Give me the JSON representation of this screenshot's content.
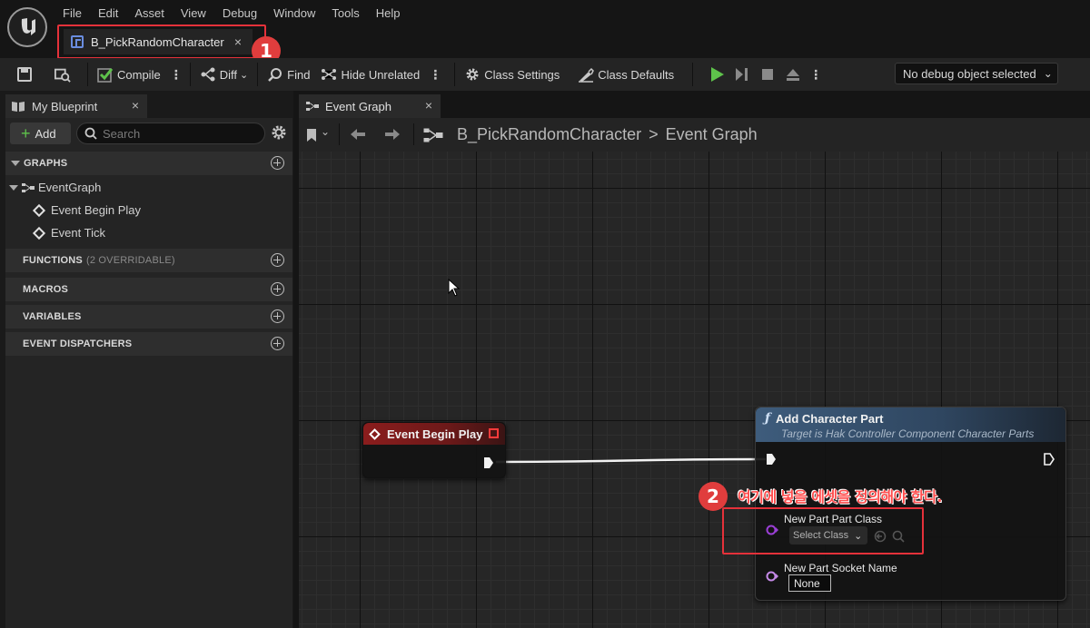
{
  "menu": [
    "File",
    "Edit",
    "Asset",
    "View",
    "Debug",
    "Window",
    "Tools",
    "Help"
  ],
  "document_tab": {
    "label": "B_PickRandomCharacter",
    "close": "×"
  },
  "badges": {
    "one": "1",
    "two": "2"
  },
  "toolbar": {
    "compile": "Compile",
    "diff": "Diff",
    "find": "Find",
    "hide_unrelated": "Hide Unrelated",
    "class_settings": "Class Settings",
    "class_defaults": "Class Defaults",
    "debug_object": "No debug object selected"
  },
  "my_blueprint": {
    "tab_label": "My Blueprint",
    "add_label": "Add",
    "search_placeholder": "Search",
    "sections": {
      "graphs": "GRAPHS",
      "functions": "FUNCTIONS",
      "functions_sub": "(2 OVERRIDABLE)",
      "macros": "MACROS",
      "variables": "VARIABLES",
      "event_dispatchers": "EVENT DISPATCHERS"
    },
    "tree": {
      "event_graph": "EventGraph",
      "event_begin_play": "Event Begin Play",
      "event_tick": "Event Tick"
    }
  },
  "graph": {
    "tab_label": "Event Graph",
    "breadcrumb_root": "B_PickRandomCharacter",
    "breadcrumb_sep": ">",
    "breadcrumb_leaf": "Event Graph"
  },
  "nodes": {
    "begin_play": {
      "title": "Event Begin Play"
    },
    "add_part": {
      "title": "Add Character Part",
      "subtitle": "Target is Hak Controller Component Character Parts",
      "pin_part_class": "New Part Part Class",
      "select_class": "Select Class",
      "pin_socket_name": "New Part Socket Name",
      "socket_value": "None"
    }
  },
  "annotation": "여기에 넣을 에셋을 정의해야 한다.",
  "colors": {
    "highlight": "#e5313a",
    "event_header": "#8b1d1d",
    "function_header": "#3e5c7c",
    "play_green": "#5ec24b",
    "object_pin": "#9b3fd6"
  }
}
